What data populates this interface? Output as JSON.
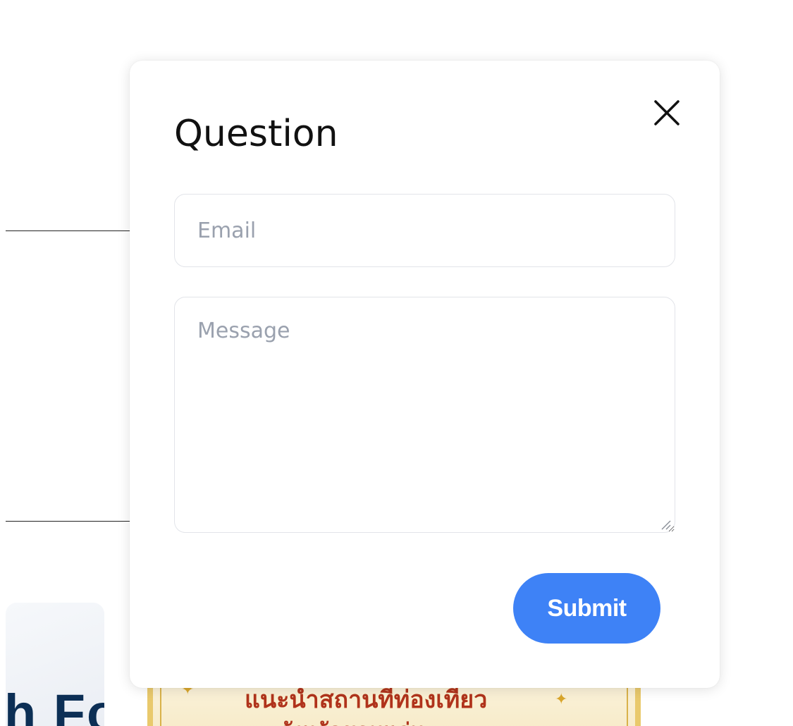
{
  "modal": {
    "title": "Question",
    "close_icon": "close-icon",
    "email": {
      "placeholder": "Email",
      "value": ""
    },
    "message": {
      "placeholder": "Message",
      "value": ""
    },
    "submit_label": "Submit",
    "accent_color": "#3e82f6"
  },
  "background": {
    "card_text": "h Fo",
    "banner_text_line1": "แนะนำสถานที่ท่องเที่ยว",
    "banner_text_line2": "จังหวัดขอนแก่น"
  }
}
